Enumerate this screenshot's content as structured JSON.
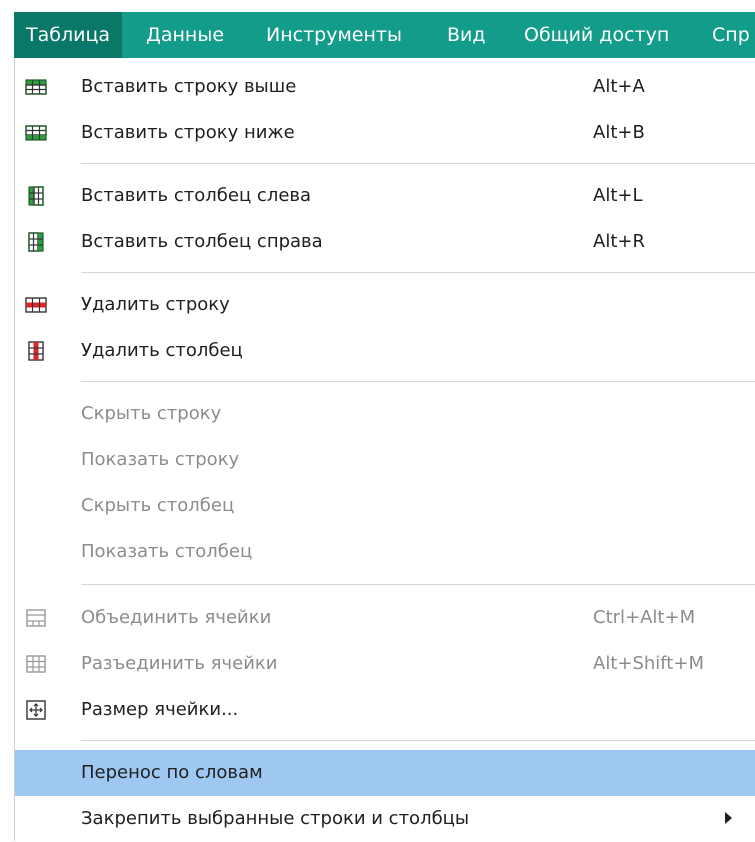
{
  "menubar": {
    "tabs": [
      {
        "label": "Таблица",
        "active": true
      },
      {
        "label": "Данные"
      },
      {
        "label": "Инструменты"
      },
      {
        "label": "Вид"
      },
      {
        "label": "Общий доступ"
      },
      {
        "label": "Спр"
      }
    ],
    "colors": {
      "bar": "#139c8a",
      "active": "#0a7868"
    }
  },
  "menu": {
    "items": [
      {
        "label": "Вставить строку выше",
        "shortcut": "Alt+A",
        "icon": "insert-row-above-icon"
      },
      {
        "label": "Вставить строку ниже",
        "shortcut": "Alt+B",
        "icon": "insert-row-below-icon"
      },
      {
        "label": "Вставить столбец слева",
        "shortcut": "Alt+L",
        "icon": "insert-column-left-icon"
      },
      {
        "label": "Вставить столбец справа",
        "shortcut": "Alt+R",
        "icon": "insert-column-right-icon"
      },
      {
        "label": "Удалить строку",
        "icon": "delete-row-icon"
      },
      {
        "label": "Удалить столбец",
        "icon": "delete-column-icon"
      },
      {
        "label": "Скрыть строку",
        "disabled": true
      },
      {
        "label": "Показать строку",
        "disabled": true
      },
      {
        "label": "Скрыть столбец",
        "disabled": true
      },
      {
        "label": "Показать столбец",
        "disabled": true
      },
      {
        "label": "Объединить ячейки",
        "shortcut": "Ctrl+Alt+M",
        "disabled": true,
        "icon": "merge-cells-icon"
      },
      {
        "label": "Разъединить ячейки",
        "shortcut": "Alt+Shift+M",
        "disabled": true,
        "icon": "split-cells-icon"
      },
      {
        "label": "Размер ячейки...",
        "icon": "cell-size-icon"
      },
      {
        "label": "Перенос по словам",
        "highlighted": true
      },
      {
        "label": "Закрепить выбранные строки и столбцы",
        "submenu": true
      }
    ],
    "highlight_color": "#9ec8f2"
  }
}
